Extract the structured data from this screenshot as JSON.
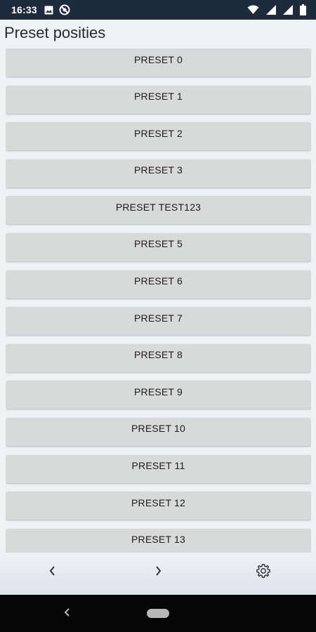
{
  "status_bar": {
    "time": "16:33",
    "icons_left": [
      "image-icon",
      "blocked-icon"
    ],
    "icons_right": [
      "wifi-icon",
      "signal-icon",
      "signal-icon",
      "battery-icon"
    ]
  },
  "page": {
    "title": "Preset posities"
  },
  "presets": [
    "PRESET 0",
    "PRESET 1",
    "PRESET 2",
    "PRESET 3",
    "PRESET TEST123",
    "PRESET 5",
    "PRESET 6",
    "PRESET 7",
    "PRESET 8",
    "PRESET 9",
    "PRESET 10",
    "PRESET 11",
    "PRESET 12",
    "PRESET 13"
  ],
  "bottom_nav": {
    "icons": [
      "chevron-left-icon",
      "chevron-right-icon",
      "settings-gear-icon"
    ]
  },
  "system_nav": {
    "icons": [
      "back-icon",
      "home-pill-icon"
    ]
  },
  "colors": {
    "status_bar": "#1e2b3c",
    "background": "#eef2f5",
    "button": "#d8d9d9",
    "system_nav": "#060606"
  }
}
